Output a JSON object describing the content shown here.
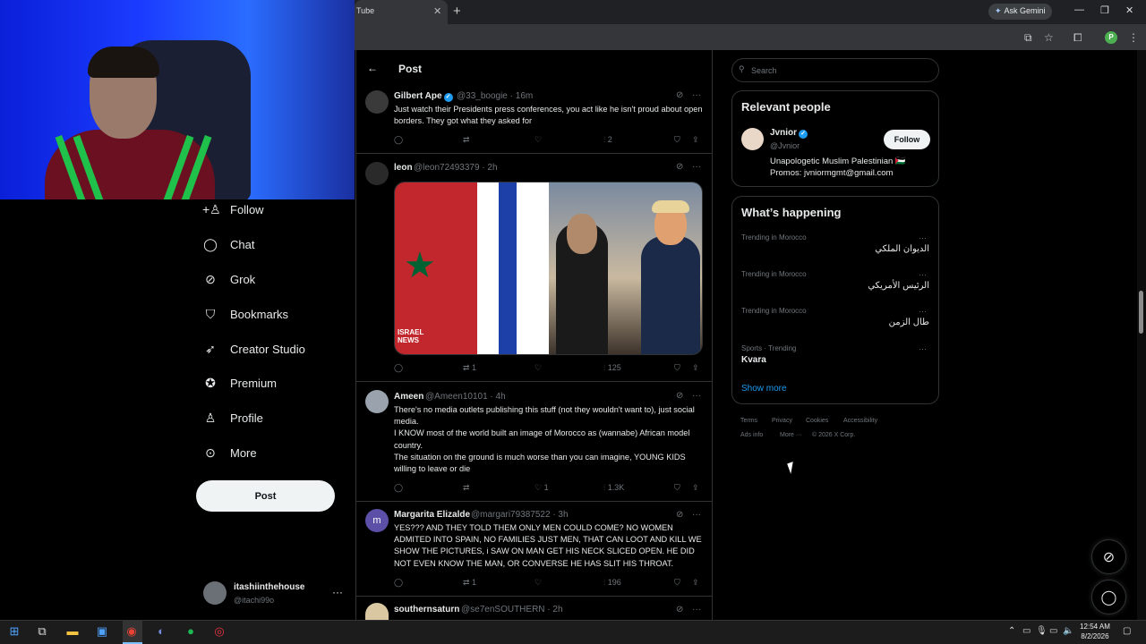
{
  "browser": {
    "tab_title": "Tube",
    "tab_close": "✕",
    "new_tab": "+",
    "gemini_label": "Ask Gemini",
    "profile_letter": "P"
  },
  "nav": {
    "items": [
      {
        "label": "Follow",
        "icon": "person-plus-icon",
        "glyph": "⁺👤"
      },
      {
        "label": "Chat",
        "icon": "chat-icon",
        "glyph": "◯"
      },
      {
        "label": "Grok",
        "icon": "grok-icon",
        "glyph": "⊘"
      },
      {
        "label": "Bookmarks",
        "icon": "bookmark-icon",
        "glyph": "⛉"
      },
      {
        "label": "Creator Studio",
        "icon": "rocket-icon",
        "glyph": "➶"
      },
      {
        "label": "Premium",
        "icon": "premium-icon",
        "glyph": "✪"
      },
      {
        "label": "Profile",
        "icon": "profile-icon",
        "glyph": "♙"
      },
      {
        "label": "More",
        "icon": "more-icon",
        "glyph": "⊙"
      }
    ],
    "post_label": "Post",
    "account_name": "itashiinthehouse",
    "account_handle": "@itachi99o",
    "account_more": "···"
  },
  "header": {
    "title": "Post",
    "back": "←"
  },
  "tweets": [
    {
      "name": "Gilbert Ape",
      "verified": true,
      "meta": "@33_boogie · 16m",
      "text": "Just watch their Presidents press conferences, you act like he isn't proud about open borders. They got what they asked for",
      "retweets": "",
      "likes": "",
      "views": "2"
    },
    {
      "name": "leon",
      "verified": false,
      "meta": "@leon72493379 · 2h",
      "text": "",
      "image_caption": "ISRAEL NEWS",
      "retweets": "1",
      "likes": "",
      "views": "125"
    },
    {
      "name": "Ameen",
      "verified": false,
      "meta": "@Ameen10101 · 4h",
      "text_lines": [
        "There's no media outlets publishing this stuff (not they wouldn't want to), just social media.",
        "I KNOW most of the world built an image of Morocco as (wannabe) African model country.",
        "The situation on the ground is much worse than you can imagine, YOUNG KIDS willing to leave or die"
      ],
      "retweets": "",
      "likes": "1",
      "views": "1.3K"
    },
    {
      "name": "Margarita Elizalde",
      "verified": false,
      "avatar_letter": "m",
      "meta": "@margari79387522 · 3h",
      "text": "YES??? AND THEY TOLD THEM ONLY MEN COULD COME? NO WOMEN ADMITED INTO SPAIN, NO FAMILIES JUST MEN, THAT CAN LOOT AND KILL WE SHOW THE PICTURES, i SAW ON MAN GET HIS NECK SLICED OPEN. HE DID NOT EVEN KNOW THE MAN, OR CONVERSE HE HAS SLIT HIS THROAT.",
      "retweets": "1",
      "likes": "",
      "views": "196"
    },
    {
      "name": "southernsaturn",
      "verified": false,
      "meta": "@se7enSOUTHERN · 2h"
    }
  ],
  "search": {
    "placeholder": "Search"
  },
  "relevant": {
    "title": "Relevant people",
    "name": "Jvnior",
    "handle": "@Jvnior",
    "bio1": "Unapologetic Muslim Palestinian 🇵🇸",
    "bio2": "Promos: jvniormgmt@gmail.com",
    "follow_label": "Follow"
  },
  "happening": {
    "title": "What’s happening",
    "trends": [
      {
        "meta": "Trending in Morocco",
        "topic": "الديوان الملكي"
      },
      {
        "meta": "Trending in Morocco",
        "topic": "الرئيس الأمريكي"
      },
      {
        "meta": "Trending in Morocco",
        "topic": "طال الزمن"
      },
      {
        "meta": "Sports · Trending",
        "topic": "Kvara"
      }
    ],
    "show_more": "Show more"
  },
  "footer": {
    "links": [
      "Terms",
      "Privacy",
      "Cookies",
      "Accessibility",
      "Ads info",
      "More ···",
      "© 2026 X Corp."
    ]
  },
  "taskbar": {
    "time": "12:54 AM",
    "date": "8/2/2026"
  }
}
